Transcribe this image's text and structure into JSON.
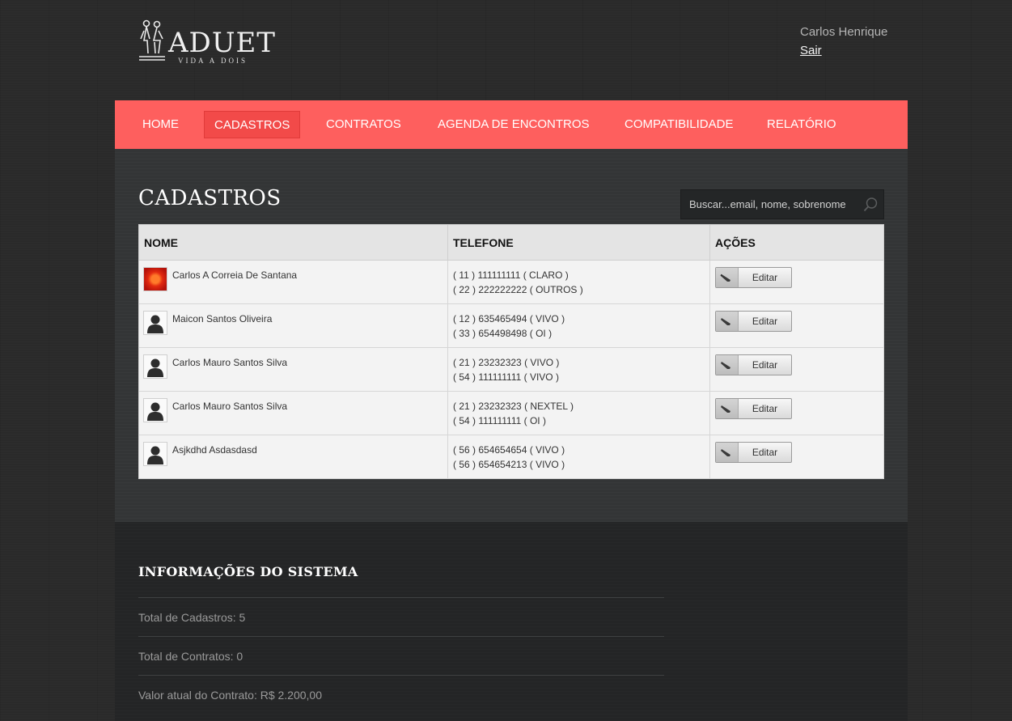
{
  "brand": {
    "name": "ADUET",
    "tagline": "VIDA A DOIS"
  },
  "user": {
    "name": "Carlos Henrique",
    "logout_label": "Sair"
  },
  "nav": {
    "items": [
      {
        "label": "HOME"
      },
      {
        "label": "CADASTROS",
        "active": true
      },
      {
        "label": "CONTRATOS"
      },
      {
        "label": "AGENDA DE ENCONTROS"
      },
      {
        "label": "COMPATIBILIDADE"
      },
      {
        "label": "RELATÓRIO"
      }
    ]
  },
  "main": {
    "title": "CADASTROS",
    "search": {
      "placeholder": "Buscar...email, nome, sobrenome",
      "value": ""
    },
    "table": {
      "headers": {
        "name": "NOME",
        "phone": "TELEFONE",
        "actions": "AÇÕES"
      },
      "edit_label": "Editar",
      "rows": [
        {
          "name": "Carlos A Correia De Santana",
          "avatar": "photo",
          "phones": [
            "( 11 ) 111111111 ( CLARO )",
            "( 22 ) 222222222 ( OUTROS )"
          ]
        },
        {
          "name": "Maicon Santos Oliveira",
          "avatar": "default-user-icon",
          "phones": [
            "( 12 ) 635465494 ( VIVO )",
            "( 33 ) 654498498 ( OI )"
          ]
        },
        {
          "name": "Carlos Mauro Santos Silva",
          "avatar": "default-user-icon",
          "phones": [
            "( 21 ) 23232323 ( VIVO )",
            "( 54 ) 111111111 ( VIVO )"
          ]
        },
        {
          "name": "Carlos Mauro Santos Silva",
          "avatar": "default-user-icon",
          "phones": [
            "( 21 ) 23232323 ( NEXTEL )",
            "( 54 ) 111111111 ( OI )"
          ]
        },
        {
          "name": "Asjkdhd Asdasdasd",
          "avatar": "default-user-icon",
          "phones": [
            "( 56 ) 654654654 ( VIVO )",
            "( 56 ) 654654213 ( VIVO )"
          ]
        }
      ]
    }
  },
  "footer": {
    "title": "INFORMAÇÕES DO SISTEMA",
    "items": [
      {
        "label": "Total de Cadastros: 5"
      },
      {
        "label": "Total de Contratos: 0"
      },
      {
        "label": "Valor atual do Contrato: R$ 2.200,00"
      }
    ]
  },
  "colors": {
    "nav": "#fe5f5e",
    "nav_active": "#f24a49",
    "background": "#2a2a2a",
    "panel": "#333536",
    "footer": "#242526"
  }
}
